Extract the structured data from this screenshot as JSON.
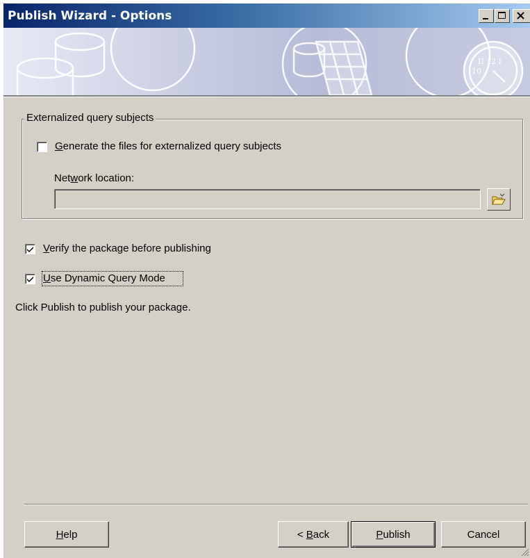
{
  "window": {
    "title": "Publish Wizard - Options",
    "controls": {
      "minimize": "minimize-icon",
      "maximize": "maximize-icon",
      "close": "close-icon"
    }
  },
  "banner": {
    "icons": [
      "database-cylinders-art",
      "database-table-art",
      "stopwatch-art"
    ]
  },
  "externalized": {
    "group_label": "Externalized query subjects",
    "generate_checkbox": {
      "label_accel": "G",
      "label_rest": "enerate the files for externalized query subjects",
      "checked": false
    },
    "network_label_pre": "Net",
    "network_label_accel": "w",
    "network_label_post": "ork location:",
    "network_value": "",
    "browse_icon": "folder-open-icon"
  },
  "options": {
    "verify": {
      "label_accel": "V",
      "label_rest": "erify the package before publishing",
      "checked": true
    },
    "dqm": {
      "label_accel": "U",
      "label_rest": "se Dynamic Query Mode",
      "checked": true
    }
  },
  "instruction": "Click Publish to publish your package.",
  "buttons": {
    "help": {
      "accel": "H",
      "rest": "elp"
    },
    "back": {
      "pre": "< ",
      "accel": "B",
      "rest": "ack"
    },
    "publish": {
      "accel": "P",
      "rest": "ublish"
    },
    "cancel": {
      "label": "Cancel"
    }
  },
  "colors": {
    "face": "#d4d0c8",
    "title_start": "#0a246a",
    "title_end": "#a6caf0"
  }
}
